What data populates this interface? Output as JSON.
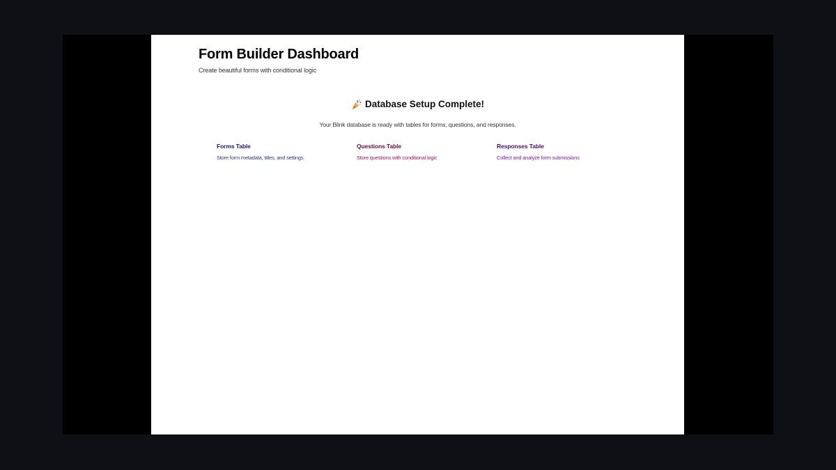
{
  "header": {
    "title": "Form Builder Dashboard",
    "subtitle": "Create beautiful forms with conditional logic"
  },
  "setup": {
    "icon": "party-popper-icon",
    "title": "Database Setup Complete!",
    "description": "Your Blink database is ready with tables for forms, questions, and responses."
  },
  "tables": [
    {
      "title": "Forms Table",
      "description": "Store form metadata, titles, and settings",
      "title_color": "#1e1b6e",
      "desc_color": "#2d3a8c"
    },
    {
      "title": "Questions Table",
      "description": "Store questions with conditional logic",
      "title_color": "#6b0f3a",
      "desc_color": "#b0126b"
    },
    {
      "title": "Responses Table",
      "description": "Collect and analyze form submissions",
      "title_color": "#4b0f6e",
      "desc_color": "#8a1aa8"
    }
  ],
  "colors": {
    "outer_background": "#0e1015",
    "frame_background": "#000000",
    "page_background": "#ffffff"
  }
}
